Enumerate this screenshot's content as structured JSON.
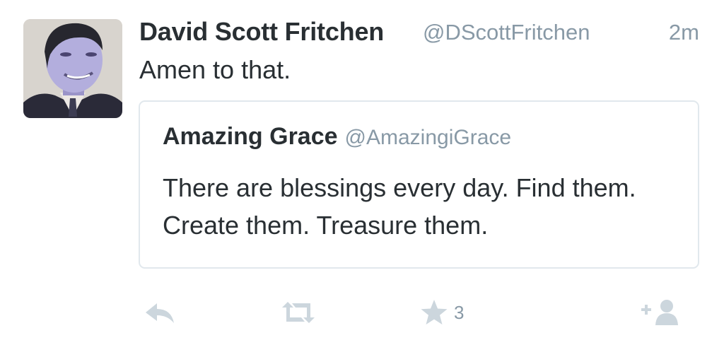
{
  "tweet": {
    "author_name": "David Scott Fritchen",
    "author_handle": "@DScottFritchen",
    "timestamp": "2m",
    "text": "Amen to that."
  },
  "quoted_tweet": {
    "author_name": "Amazing Grace",
    "author_handle": "@AmazingiGrace",
    "text": "There are blessings every day. Find them. Create them. Treasure them."
  },
  "actions": {
    "reply_icon": "reply-icon",
    "retweet_icon": "retweet-icon",
    "favorite_icon": "star-icon",
    "favorite_count": "3",
    "follow_icon": "follow-icon"
  },
  "colors": {
    "primary_text": "#292f33",
    "secondary_text": "#8899a6",
    "card_border": "#e1e8ed",
    "action_icon": "#ccd6dd"
  }
}
